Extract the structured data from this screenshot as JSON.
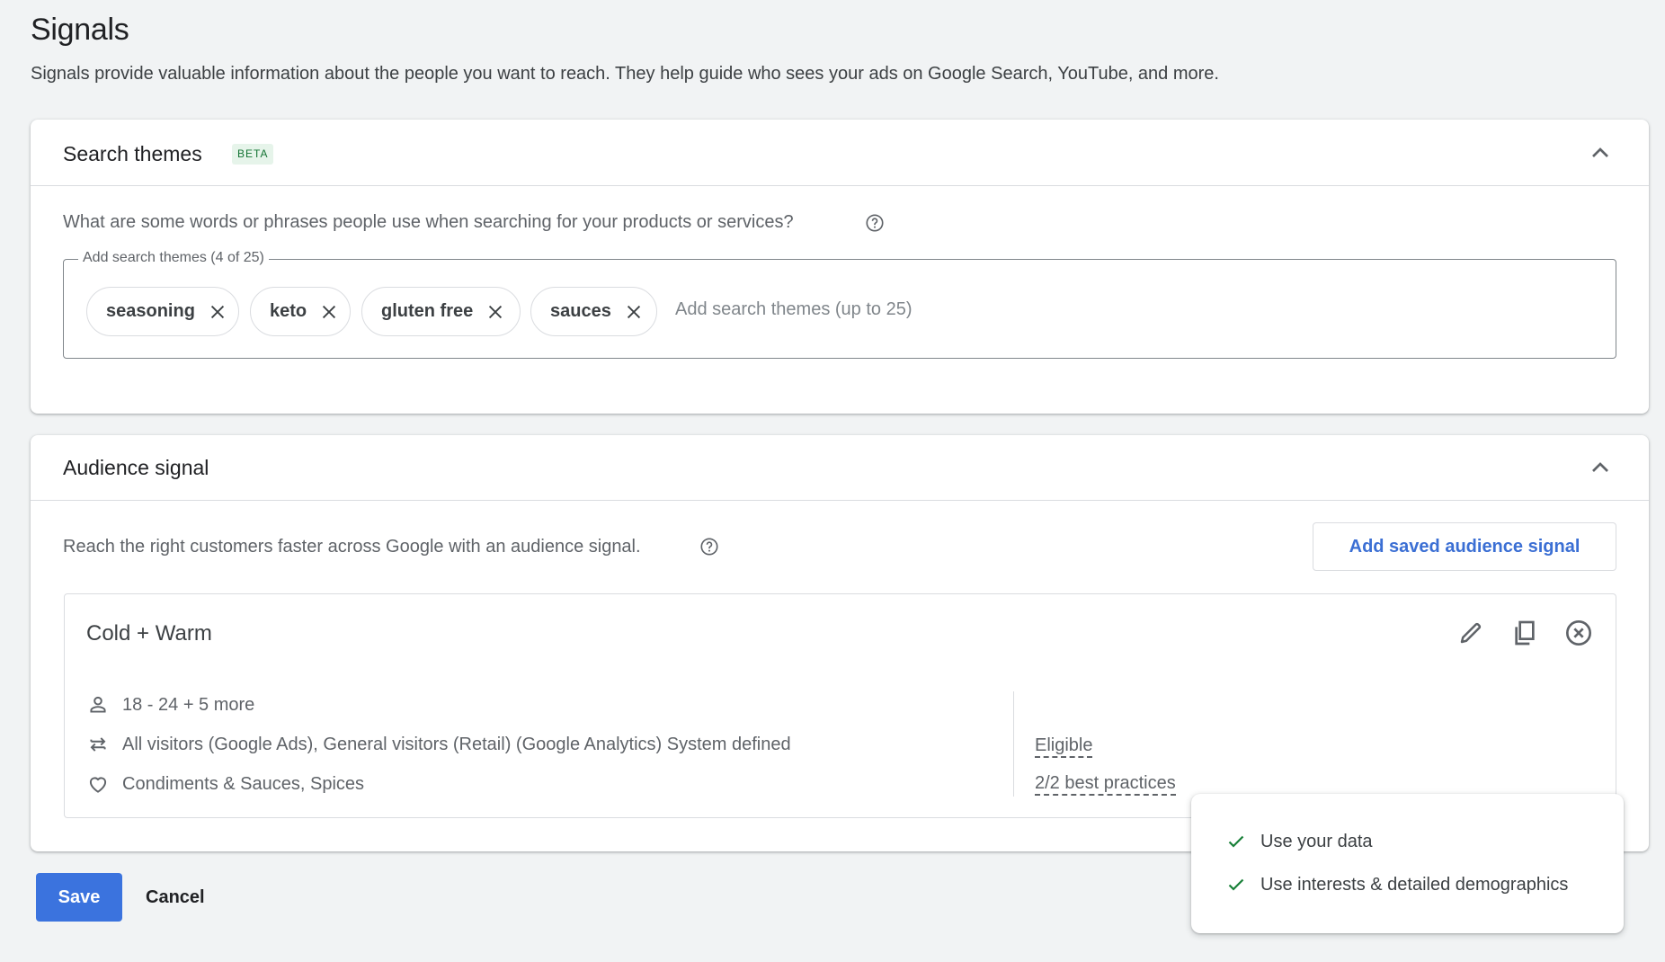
{
  "page": {
    "title": "Signals",
    "subtitle": "Signals provide valuable information about the people you want to reach. They help guide who sees your ads on Google Search, YouTube, and more."
  },
  "search_themes": {
    "title": "Search themes",
    "badge": "BETA",
    "question": "What are some words or phrases people use when searching for your products or services?",
    "field_label": "Add search themes (4 of 25)",
    "placeholder": "Add search themes (up to 25)",
    "chips": [
      {
        "label": "seasoning"
      },
      {
        "label": "keto"
      },
      {
        "label": "gluten free"
      },
      {
        "label": "sauces"
      }
    ],
    "icons": {
      "collapse": "chevron-up-icon",
      "help": "help-circle-icon",
      "remove": "close-icon"
    }
  },
  "audience_signal": {
    "title": "Audience signal",
    "description": "Reach the right customers faster across Google with an audience signal.",
    "add_button": "Add saved audience signal",
    "signal": {
      "name": "Cold + Warm",
      "rows": [
        {
          "icon": "person-icon",
          "text": "18 - 24 + 5 more"
        },
        {
          "icon": "swap-arrows-icon",
          "text": "All visitors (Google Ads), General visitors (Retail) (Google Analytics) System defined"
        },
        {
          "icon": "heart-icon",
          "text": "Condiments & Sauces, Spices"
        }
      ],
      "status": "Eligible",
      "best_practices": "2/2 best practices",
      "actions": [
        "edit-icon",
        "copy-icon",
        "remove-icon"
      ]
    },
    "popup": {
      "items": [
        {
          "icon": "check-icon",
          "text": "Use your data"
        },
        {
          "icon": "check-icon",
          "text": "Use interests & detailed demographics"
        }
      ]
    }
  },
  "footer": {
    "save": "Save",
    "cancel": "Cancel"
  },
  "colors": {
    "primary": "#3b73de",
    "link": "#3b6fd4",
    "success": "#188038",
    "badge_bg": "#e6f4ea"
  }
}
